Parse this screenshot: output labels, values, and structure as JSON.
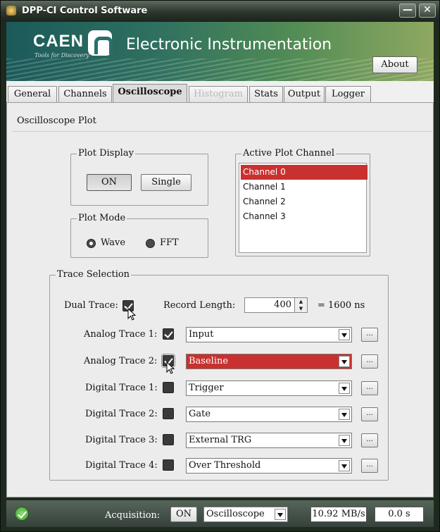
{
  "window": {
    "title": "DPP-CI Control Software"
  },
  "banner": {
    "brand": "CAEN",
    "tagline": "Tools for Discovery",
    "heading": "Electronic Instrumentation",
    "about_label": "About"
  },
  "tabs": [
    {
      "label": "General",
      "state": "normal"
    },
    {
      "label": "Channels",
      "state": "normal"
    },
    {
      "label": "Oscilloscope",
      "state": "active"
    },
    {
      "label": "Histogram",
      "state": "disabled"
    },
    {
      "label": "Stats",
      "state": "normal"
    },
    {
      "label": "Output",
      "state": "normal"
    },
    {
      "label": "Logger",
      "state": "normal"
    }
  ],
  "section": {
    "title": "Oscilloscope Plot"
  },
  "plot_display": {
    "label": "Plot Display",
    "on_label": "ON",
    "single_label": "Single"
  },
  "plot_mode": {
    "label": "Plot Mode",
    "options": [
      "Wave",
      "FFT"
    ],
    "selected": "Wave"
  },
  "active_channel": {
    "label": "Active Plot  Channel",
    "items": [
      "Channel 0",
      "Channel 1",
      "Channel 2",
      "Channel 3"
    ],
    "selected": "Channel 0"
  },
  "trace_selection": {
    "label": "Trace Selection",
    "dual_trace_label": "Dual Trace:",
    "dual_trace_checked": true,
    "record_length_label": "Record Length:",
    "record_length_value": "400",
    "record_length_ns": "= 1600 ns",
    "traces": [
      {
        "label": "Analog Trace 1:",
        "checked": true,
        "value": "Input",
        "highlighted": false
      },
      {
        "label": "Analog Trace 2:",
        "checked": true,
        "value": "Baseline",
        "highlighted": true
      },
      {
        "label": "Digital Trace 1:",
        "checked": false,
        "value": "Trigger",
        "highlighted": false
      },
      {
        "label": "Digital Trace 2:",
        "checked": false,
        "value": "Gate",
        "highlighted": false
      },
      {
        "label": "Digital Trace 3:",
        "checked": false,
        "value": "External TRG",
        "highlighted": false
      },
      {
        "label": "Digital Trace 4:",
        "checked": false,
        "value": "Over Threshold",
        "highlighted": false
      }
    ],
    "more_label": "..."
  },
  "statusbar": {
    "acquisition_label": "Acquisition:",
    "acquisition_button": "ON",
    "mode_value": "Oscilloscope",
    "rate": "10.92 MB/s",
    "time": "0.0 s"
  },
  "colors": {
    "selection": "#c8312f",
    "status_ok": "#4caf35"
  }
}
